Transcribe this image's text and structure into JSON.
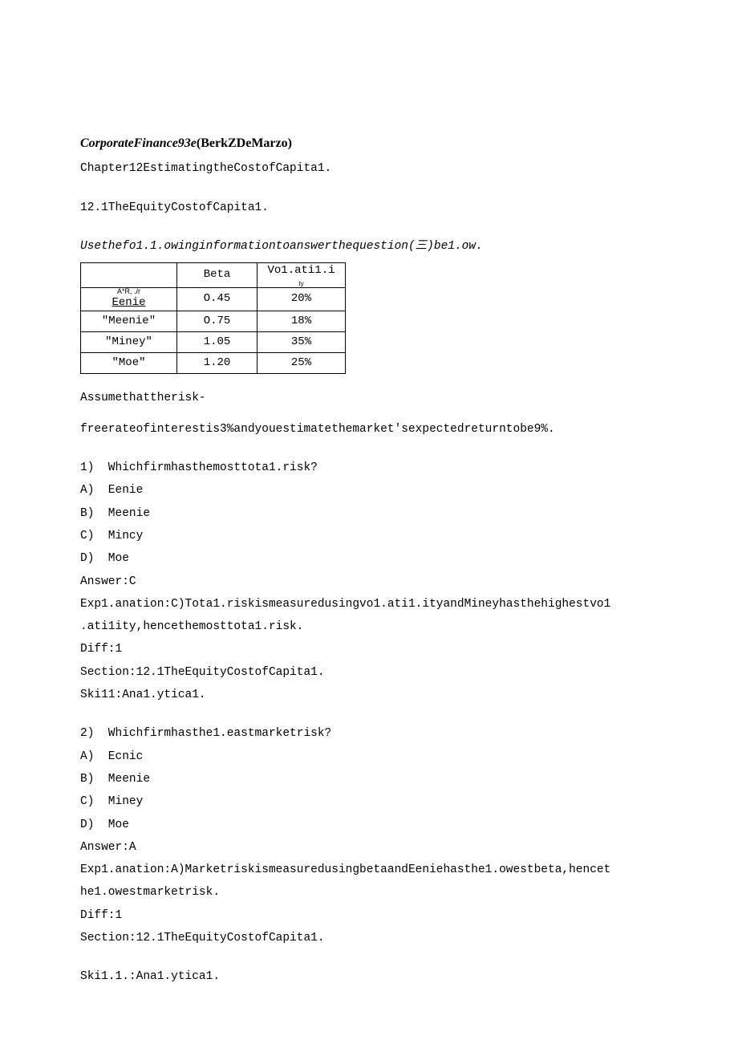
{
  "title": {
    "italic": "CorporateFinance93e",
    "regular": "(BerkZDeMarzo)"
  },
  "chapter": "Chapter12EstimatingtheCostofCapita1.",
  "section": "12.1TheEquityCostofCapita1.",
  "instruction": "Usethefo1.1.owinginformationtoanswerthequestion(三)be1.ow.",
  "table": {
    "headers": {
      "c0": "",
      "c1": "Beta",
      "c2_top": "Vo1.ati1.i",
      "c2_sub": "ty"
    },
    "rows": [
      {
        "c0_top": "A*R,  ./r",
        "c0_bottom": "Eenie",
        "c1": "O.45",
        "c2": "20%"
      },
      {
        "c0": "\"Meenie\"",
        "c1": "O.75",
        "c2": "18%"
      },
      {
        "c0": "\"Miney\"",
        "c1": "1.05",
        "c2": "35%"
      },
      {
        "c0": "\"Moe\"",
        "c1": "1.20",
        "c2": "25%"
      }
    ]
  },
  "assume1": "Assumethattherisk-",
  "assume2": "freerateofinterestis3%andyouestimatethemarket'sexpectedreturntobe9%.",
  "q1": {
    "q": "1)  Whichfirmhasthemosttota1.risk?",
    "a": "A)  Eenie",
    "b": "B)  Meenie",
    "c": "C)  Mincy",
    "d": "D)  Moe",
    "ans": "Answer:C",
    "exp1": "Exp1.anation:C)Tota1.riskismeasuredusingvo1.ati1.ityandMineyhasthehighestvo1",
    "exp2": ".ati1ity,hencethemosttota1.risk.",
    "diff": "Diff:1",
    "sect": "Section:12.1TheEquityCostofCapita1.",
    "skill": "Ski11:Ana1.ytica1."
  },
  "q2": {
    "q": "2)  Whichfirmhasthe1.eastmarketrisk?",
    "a": "A)  Ecnic",
    "b": "B)  Meenie",
    "c": "C)  Miney",
    "d": "D)  Moe",
    "ans": "Answer:A",
    "exp1": "Exp1.anation:A)MarketriskismeasuredusingbetaandEeniehasthe1.owestbeta,hencet",
    "exp2": "he1.owestmarketrisk.",
    "diff": "Diff:1",
    "sect": "Section:12.1TheEquityCostofCapita1.",
    "skill": "Ski1.1.:Ana1.ytica1."
  }
}
